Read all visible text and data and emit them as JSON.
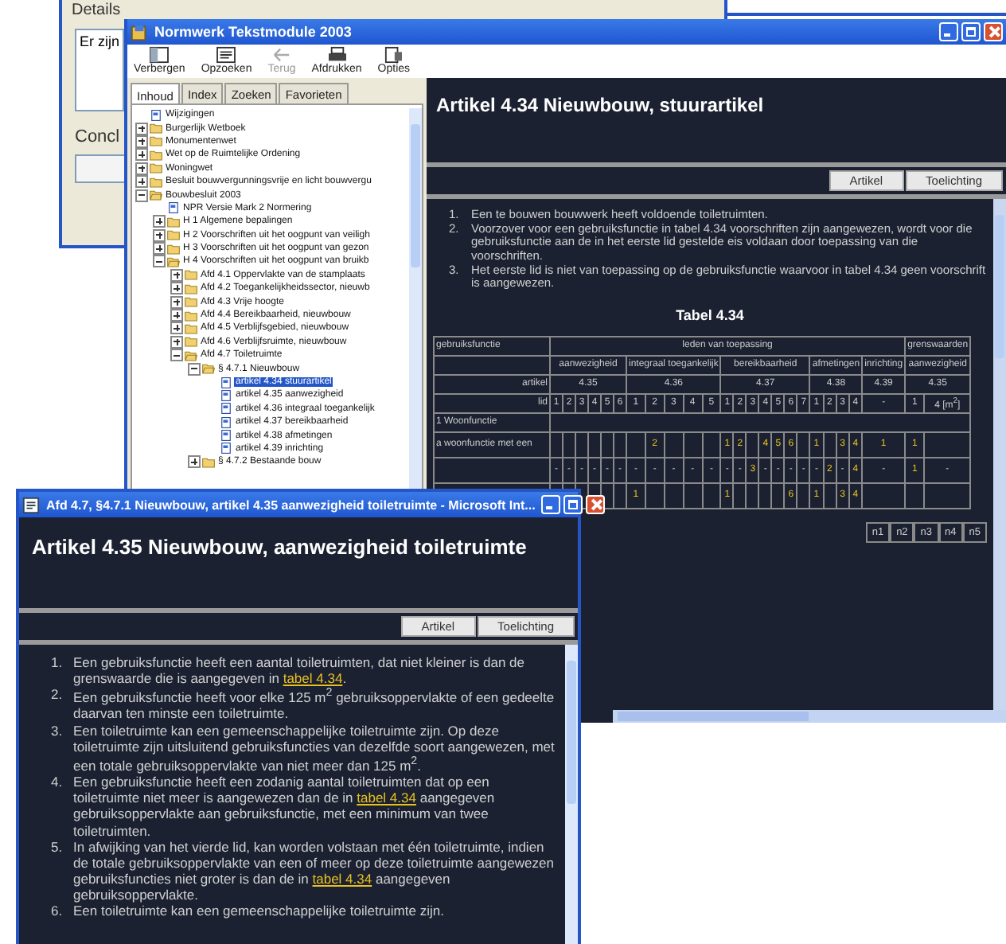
{
  "background_window": {
    "details_label": "Details",
    "details_text": "Er zijn",
    "conclusion_label": "Concl"
  },
  "main_window": {
    "title": "Normwerk Tekstmodule 2003",
    "toolbar": [
      {
        "label": "Verbergen",
        "kind": "hide",
        "disabled": false
      },
      {
        "label": "Opzoeken",
        "kind": "locate",
        "disabled": false
      },
      {
        "label": "Terug",
        "kind": "back",
        "disabled": true
      },
      {
        "label": "Afdrukken",
        "kind": "print",
        "disabled": false
      },
      {
        "label": "Opties",
        "kind": "options",
        "disabled": false
      }
    ],
    "tabs": [
      {
        "label": "Inhoud",
        "selected": true
      },
      {
        "label": "Index",
        "selected": false
      },
      {
        "label": "Zoeken",
        "selected": false
      },
      {
        "label": "Favorieten",
        "selected": false
      }
    ],
    "tree": [
      {
        "label": "Wijzigingen",
        "kind": "page",
        "selected": false
      },
      {
        "label": "Burgerlijk Wetboek",
        "kind": "folder",
        "expanded": false,
        "selected": false
      },
      {
        "label": "Monumentenwet",
        "kind": "folder",
        "expanded": false,
        "selected": false
      },
      {
        "label": "Wet op de Ruimtelijke Ordening",
        "kind": "folder",
        "expanded": false,
        "selected": false
      },
      {
        "label": "Woningwet",
        "kind": "folder",
        "expanded": false,
        "selected": false
      },
      {
        "label": "Besluit bouwvergunningsvrije en licht bouwvergu",
        "kind": "folder",
        "expanded": false,
        "selected": false
      },
      {
        "label": "Bouwbesluit 2003",
        "kind": "folder",
        "expanded": true,
        "selected": false,
        "children": [
          {
            "label": "NPR Versie Mark 2 Normering",
            "kind": "page",
            "selected": false
          },
          {
            "label": "H 1 Algemene bepalingen",
            "kind": "folder",
            "expanded": false,
            "selected": false
          },
          {
            "label": "H 2 Voorschriften uit het oogpunt van veiligh",
            "kind": "folder",
            "expanded": false,
            "selected": false
          },
          {
            "label": "H 3 Voorschriften uit het oogpunt van gezon",
            "kind": "folder",
            "expanded": false,
            "selected": false
          },
          {
            "label": "H 4 Voorschriften uit het oogpunt van bruikb",
            "kind": "folder",
            "expanded": true,
            "selected": false,
            "children": [
              {
                "label": "Afd 4.1 Oppervlakte van de stamplaats",
                "kind": "folder",
                "expanded": false,
                "selected": false
              },
              {
                "label": "Afd 4.2 Toegankelijkheidssector, nieuwb",
                "kind": "folder",
                "expanded": false,
                "selected": false
              },
              {
                "label": "Afd 4.3 Vrije hoogte",
                "kind": "folder",
                "expanded": false,
                "selected": false
              },
              {
                "label": "Afd 4.4 Bereikbaarheid, nieuwbouw",
                "kind": "folder",
                "expanded": false,
                "selected": false
              },
              {
                "label": "Afd 4.5 Verblijfsgebied, nieuwbouw",
                "kind": "folder",
                "expanded": false,
                "selected": false
              },
              {
                "label": "Afd 4.6 Verblijfsruimte, nieuwbouw",
                "kind": "folder",
                "expanded": false,
                "selected": false
              },
              {
                "label": "Afd 4.7 Toiletruimte",
                "kind": "folder",
                "expanded": true,
                "selected": false,
                "children": [
                  {
                    "label": "§ 4.7.1 Nieuwbouw",
                    "kind": "folder",
                    "expanded": true,
                    "selected": false,
                    "children": [
                      {
                        "label": "artikel 4.34 stuurartikel",
                        "kind": "page",
                        "selected": true
                      },
                      {
                        "label": "artikel 4.35 aanwezigheid",
                        "kind": "page",
                        "selected": false
                      },
                      {
                        "label": "artikel 4.36 integraal toegankelijk",
                        "kind": "page",
                        "selected": false
                      },
                      {
                        "label": "artikel 4.37 bereikbaarheid",
                        "kind": "page",
                        "selected": false
                      },
                      {
                        "label": "artikel 4.38 afmetingen",
                        "kind": "page",
                        "selected": false
                      },
                      {
                        "label": "artikel 4.39 inrichting",
                        "kind": "page",
                        "selected": false
                      }
                    ]
                  },
                  {
                    "label": "§ 4.7.2 Bestaande bouw",
                    "kind": "folder",
                    "expanded": false,
                    "selected": false
                  }
                ]
              }
            ]
          }
        ]
      }
    ],
    "article": {
      "heading": "Artikel 4.34 Nieuwbouw, stuurartikel",
      "buttons": [
        "Artikel",
        "Toelichting"
      ],
      "items": [
        {
          "number": "1.",
          "text": "Een te bouwen bouwwerk heeft voldoende toiletruimten."
        },
        {
          "number": "2.",
          "text": "Voorzover voor een gebruiksfunctie in tabel 4.34 voorschriften zijn aangewezen, wordt voor die gebruiksfunctie aan de in het eerste lid gestelde eis voldaan door toepassing van die voorschriften."
        },
        {
          "number": "3.",
          "text": "Het eerste lid is niet van toepassing op de gebruiksfunctie waarvoor in tabel 4.34 geen voorschrift is aangewezen."
        }
      ],
      "table_title": "Tabel 4.34",
      "table": {
        "header_label": "gebruiksfunctie",
        "leden_heading": "leden van toepassing",
        "limits_heading": "grenswaarden",
        "article_label": "artikel",
        "lid_label": "lid",
        "groups": [
          {
            "heading": "aanwezigheid",
            "article": "4.35",
            "lids": [
              "1",
              "2",
              "3",
              "4",
              "5",
              "6"
            ]
          },
          {
            "heading": "integraal toegankelijk",
            "article": "4.36",
            "lids": [
              "1",
              "2",
              "3",
              "4",
              "5"
            ]
          },
          {
            "heading": "bereikbaarheid",
            "article": "4.37",
            "lids": [
              "1",
              "2",
              "3",
              "4",
              "5",
              "6",
              "7"
            ]
          },
          {
            "heading": "afmetingen",
            "article": "4.38",
            "lids": [
              "1",
              "2",
              "3",
              "4"
            ]
          },
          {
            "heading": "inrichting",
            "article": "4.39",
            "lids": [
              "-"
            ]
          }
        ],
        "limit_groups": [
          {
            "heading": "aanwezigheid",
            "article": "4.35",
            "lids": [
              "1",
              "4 [m$^{2}$]"
            ]
          }
        ],
        "section_row": "1  Woonfunctie",
        "rows": [
          {
            "label": "a woonfunctie met een",
            "cells": [
              {
                "kind": "blank"
              },
              {
                "kind": "blank"
              },
              {
                "kind": "blank"
              },
              {
                "kind": "blank"
              },
              {
                "kind": "blank"
              },
              {
                "kind": "blank"
              },
              {
                "kind": "blank"
              },
              {
                "kind": "link",
                "text": "2"
              },
              {
                "kind": "blank"
              },
              {
                "kind": "blank"
              },
              {
                "kind": "blank"
              },
              {
                "kind": "link",
                "text": "1"
              },
              {
                "kind": "link",
                "text": "2"
              },
              {
                "kind": "blank"
              },
              {
                "kind": "link",
                "text": "4"
              },
              {
                "kind": "link",
                "text": "5"
              },
              {
                "kind": "link",
                "text": "6"
              },
              {
                "kind": "blank"
              },
              {
                "kind": "link",
                "text": "1"
              },
              {
                "kind": "blank"
              },
              {
                "kind": "link",
                "text": "3"
              },
              {
                "kind": "link",
                "text": "4"
              },
              {
                "kind": "link",
                "text": "1"
              },
              {
                "kind": "link",
                "text": "1"
              },
              {
                "kind": "blank"
              }
            ]
          },
          {
            "cells": [
              {
                "kind": "plain",
                "text": "-"
              },
              {
                "kind": "plain",
                "text": "-"
              },
              {
                "kind": "plain",
                "text": "-"
              },
              {
                "kind": "plain",
                "text": "-"
              },
              {
                "kind": "plain",
                "text": "-"
              },
              {
                "kind": "plain",
                "text": "-"
              },
              {
                "kind": "plain",
                "text": "-"
              },
              {
                "kind": "plain",
                "text": "-"
              },
              {
                "kind": "plain",
                "text": "-"
              },
              {
                "kind": "plain",
                "text": "-"
              },
              {
                "kind": "plain",
                "text": "-"
              },
              {
                "kind": "plain",
                "text": "-"
              },
              {
                "kind": "plain",
                "text": "-"
              },
              {
                "kind": "link",
                "text": "3"
              },
              {
                "kind": "plain",
                "text": "-"
              },
              {
                "kind": "plain",
                "text": "-"
              },
              {
                "kind": "plain",
                "text": "-"
              },
              {
                "kind": "plain",
                "text": "-"
              },
              {
                "kind": "plain",
                "text": "-"
              },
              {
                "kind": "link",
                "text": "2"
              },
              {
                "kind": "plain",
                "text": "-"
              },
              {
                "kind": "link",
                "text": "4"
              },
              {
                "kind": "plain",
                "text": "-"
              },
              {
                "kind": "link",
                "text": "1"
              },
              {
                "kind": "plain",
                "text": "-"
              }
            ]
          },
          {
            "cells": [
              {
                "kind": "blank"
              },
              {
                "kind": "blank"
              },
              {
                "kind": "blank"
              },
              {
                "kind": "blank"
              },
              {
                "kind": "blank"
              },
              {
                "kind": "blank"
              },
              {
                "kind": "link",
                "text": "1"
              },
              {
                "kind": "blank"
              },
              {
                "kind": "blank"
              },
              {
                "kind": "blank"
              },
              {
                "kind": "blank"
              },
              {
                "kind": "link",
                "text": "1"
              },
              {
                "kind": "blank"
              },
              {
                "kind": "blank"
              },
              {
                "kind": "blank"
              },
              {
                "kind": "blank"
              },
              {
                "kind": "link",
                "text": "6"
              },
              {
                "kind": "blank"
              },
              {
                "kind": "link",
                "text": "1"
              },
              {
                "kind": "blank"
              },
              {
                "kind": "link",
                "text": "3"
              },
              {
                "kind": "link",
                "text": "4"
              },
              {
                "kind": "blank"
              },
              {
                "kind": "blank"
              },
              {
                "kind": "blank"
              }
            ]
          }
        ]
      },
      "sub_headers": [
        "n1",
        "n2",
        "n3",
        "n4",
        "n5"
      ]
    }
  },
  "popup_window": {
    "title": "Afd 4.7, §4.7.1 Nieuwbouw, artikel 4.35 aanwezigheid toiletruimte - Microsoft Int...",
    "heading": "Artikel 4.35 Nieuwbouw, aanwezigheid toiletruimte",
    "buttons": [
      "Artikel",
      "Toelichting"
    ],
    "items": [
      {
        "number": "1.",
        "text": "Een gebruiksfunctie heeft een aantal toiletruimten, dat niet kleiner is dan de grenswaarde die is aangegeven in ",
        "link": "tabel 4.34",
        "after": "."
      },
      {
        "number": "2.",
        "text": "Een gebruiksfunctie heeft voor elke 125 m$^{2}$ gebruiksoppervlakte of een gedeelte daarvan ten minste een toiletruimte."
      },
      {
        "number": "3.",
        "text": "Een toiletruimte kan een gemeenschappelijke toiletruimte zijn. Op deze toiletruimte zijn uitsluitend gebruiksfuncties van dezelfde soort aangewezen, met een totale gebruiksoppervlakte van niet meer dan 125 m$^{2}$."
      },
      {
        "number": "4.",
        "text": "Een gebruiksfunctie heeft een zodanig aantal toiletruimten dat op een toiletruimte niet meer is aangewezen dan de in ",
        "link": "tabel 4.34",
        "after": " aangegeven gebruiksoppervlakte aan gebruiksfunctie, met een minimum van twee toiletruimten."
      },
      {
        "number": "5.",
        "text": "In afwijking van het vierde lid, kan worden volstaan met één toiletruimte, indien de totale gebruiksoppervlakte van een of meer op deze toiletruimte aangewezen gebruiksfuncties niet groter is dan de in ",
        "link": "tabel 4.34",
        "after": " aangegeven gebruiksoppervlakte."
      },
      {
        "number": "6.",
        "text": "Een toiletruimte kan een gemeenschappelijke toiletruimte zijn."
      }
    ]
  }
}
